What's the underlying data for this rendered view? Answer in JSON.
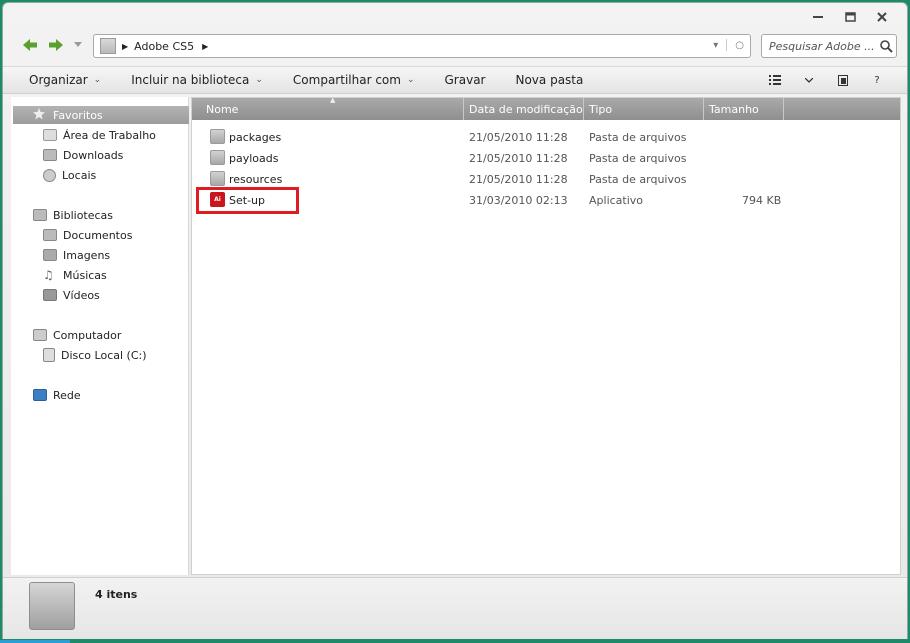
{
  "window": {
    "caption": {
      "minimize": "–",
      "maximize": "□",
      "close": "✕"
    }
  },
  "address": {
    "crumbs": [
      "Adobe CS5"
    ],
    "refresh_glyph": "○",
    "dropdown_glyph": "▾"
  },
  "search": {
    "placeholder": "Pesquisar Adobe ..."
  },
  "toolbar": {
    "organize": "Organizar",
    "include_library": "Incluir na biblioteca",
    "share": "Compartilhar com",
    "burn": "Gravar",
    "new_folder": "Nova pasta",
    "help": "?"
  },
  "sidebar": {
    "favorites": {
      "label": "Favoritos",
      "items": [
        "Área de Trabalho",
        "Downloads",
        "Locais"
      ]
    },
    "libraries": {
      "label": "Bibliotecas",
      "items": [
        "Documentos",
        "Imagens",
        "Músicas",
        "Vídeos"
      ]
    },
    "computer": {
      "label": "Computador",
      "items": [
        "Disco Local (C:)"
      ]
    },
    "network": {
      "label": "Rede"
    }
  },
  "columns": {
    "name": "Nome",
    "date": "Data de modificação",
    "type": "Tipo",
    "size": "Tamanho"
  },
  "files": [
    {
      "name": "packages",
      "date": "21/05/2010 11:28",
      "type": "Pasta de arquivos",
      "size": "",
      "icon": "folder-icon"
    },
    {
      "name": "payloads",
      "date": "21/05/2010 11:28",
      "type": "Pasta de arquivos",
      "size": "",
      "icon": "folder-icon"
    },
    {
      "name": "resources",
      "date": "21/05/2010 11:28",
      "type": "Pasta de arquivos",
      "size": "",
      "icon": "folder-icon"
    },
    {
      "name": "Set-up",
      "date": "31/03/2010 02:13",
      "type": "Aplicativo",
      "size": "794 KB",
      "icon": "adobe-app-icon"
    }
  ],
  "app_icon_text": "Ai",
  "status": {
    "item_count": "4 itens"
  },
  "colors": {
    "highlight": "#e01b22",
    "nav_arrow": "#5aa02c",
    "app_icon": "#c8141a"
  }
}
